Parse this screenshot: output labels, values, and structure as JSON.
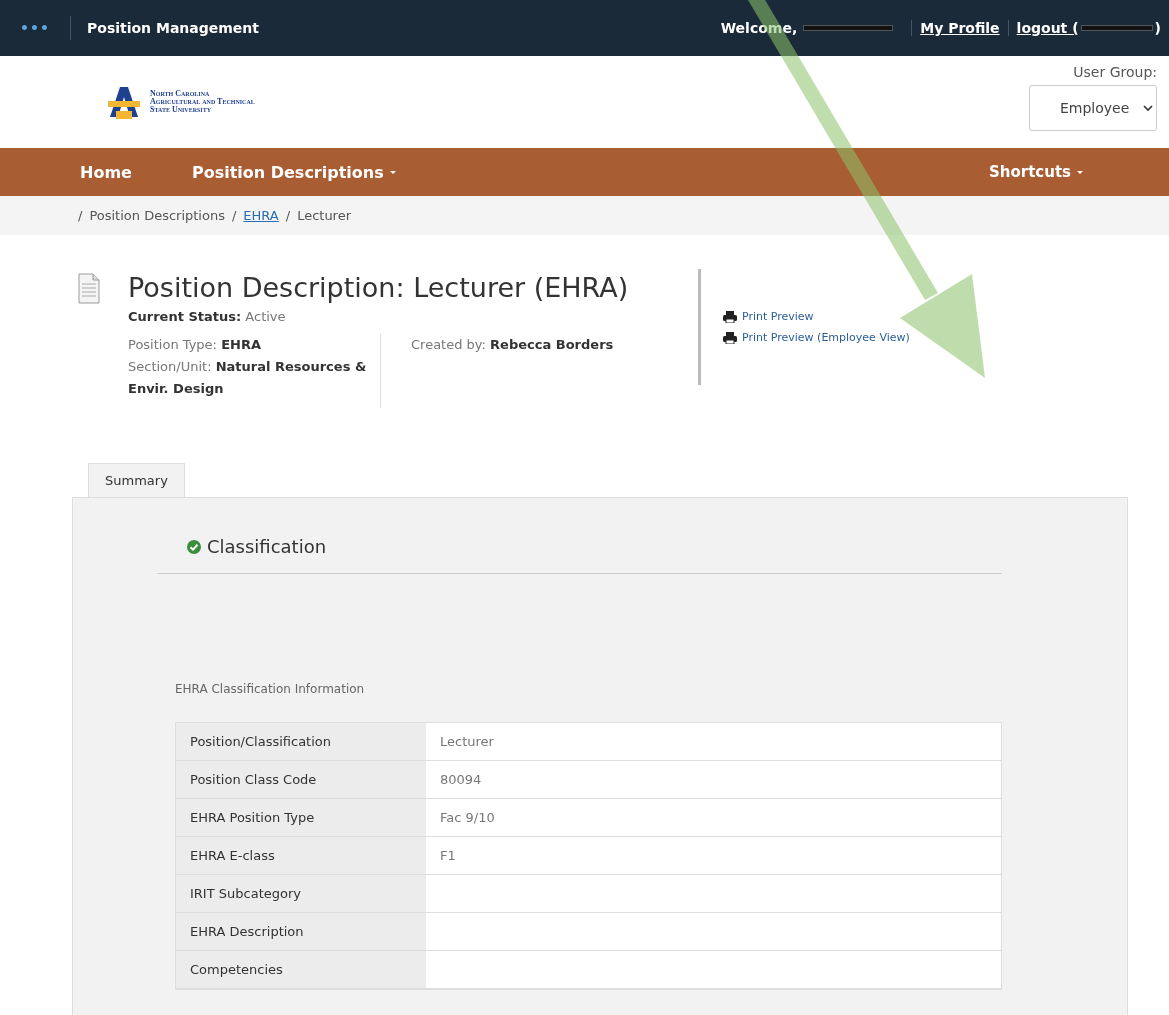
{
  "top_bar": {
    "menu_glyph": "•••",
    "title": "Position Management",
    "welcome": "Welcome,",
    "links": [
      {
        "label": "My Profile",
        "redacted_after": false
      },
      {
        "label": "logout (",
        "redacted_after": true,
        "suffix": ")"
      }
    ]
  },
  "logo": {
    "lines": [
      "North Carolina",
      "Agricultural and Technical",
      "State University"
    ]
  },
  "user_group": {
    "label": "User Group:",
    "value": "Employee"
  },
  "nav": {
    "items": [
      {
        "label": "Home",
        "dropdown": false
      },
      {
        "label": "Position Descriptions",
        "dropdown": true
      }
    ],
    "right": {
      "label": "Shortcuts",
      "dropdown": true
    }
  },
  "breadcrumb": [
    {
      "separator": "/",
      "label": "Position Descriptions",
      "link": false
    },
    {
      "separator": "/",
      "label": "EHRA",
      "link": true
    },
    {
      "separator": "/",
      "label": "Lecturer",
      "link": false
    }
  ],
  "header": {
    "title": "Position Description: Lecturer (EHRA)",
    "status_label": "Current Status:",
    "status": "Active",
    "fields": [
      {
        "label": "Position Type:",
        "value": "EHRA"
      },
      {
        "label": "Section/Unit:",
        "value": "Natural Resources & Envir. Design"
      }
    ],
    "created_label": "Created by:",
    "created_by": "Rebecca Borders",
    "actions": [
      "Print Preview",
      "Print Preview (Employee View)"
    ]
  },
  "tabs": [
    {
      "label": "Summary",
      "selected": true
    }
  ],
  "section": {
    "title": "Classification",
    "complete": true,
    "subtitle": "EHRA Classification Information",
    "rows": [
      {
        "label": "Position/Classification",
        "value": "Lecturer"
      },
      {
        "label": "Position Class Code",
        "value": "80094"
      },
      {
        "label": "EHRA Position Type",
        "value": "Fac 9/10"
      },
      {
        "label": "EHRA E-class",
        "value": "F1"
      },
      {
        "label": "IRIT Subcategory"
      },
      {
        "label": "EHRA Description"
      },
      {
        "label": "Competencies"
      }
    ]
  }
}
